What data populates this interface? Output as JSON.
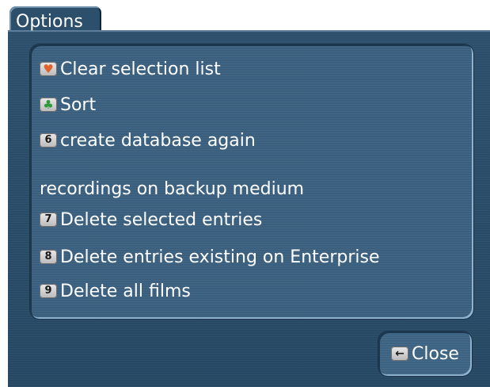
{
  "dialog": {
    "tab_title": "Options"
  },
  "menu": {
    "items": [
      {
        "key": "♥",
        "key_name": "heart-key-icon",
        "label": "Clear selection list"
      },
      {
        "key": "♣",
        "key_name": "club-key-icon",
        "label": "Sort"
      },
      {
        "key": "6",
        "key_name": "key-6-icon",
        "label": "create database again"
      }
    ],
    "section_label": "recordings on backup medium",
    "backup_items": [
      {
        "key": "7",
        "key_name": "key-7-icon",
        "label": "Delete selected entries"
      },
      {
        "key": "8",
        "key_name": "key-8-icon",
        "label": "Delete entries existing on Enterprise"
      },
      {
        "key": "9",
        "key_name": "key-9-icon",
        "label": "Delete all films"
      }
    ]
  },
  "footer": {
    "close_key": "←",
    "close_label": "Close"
  }
}
